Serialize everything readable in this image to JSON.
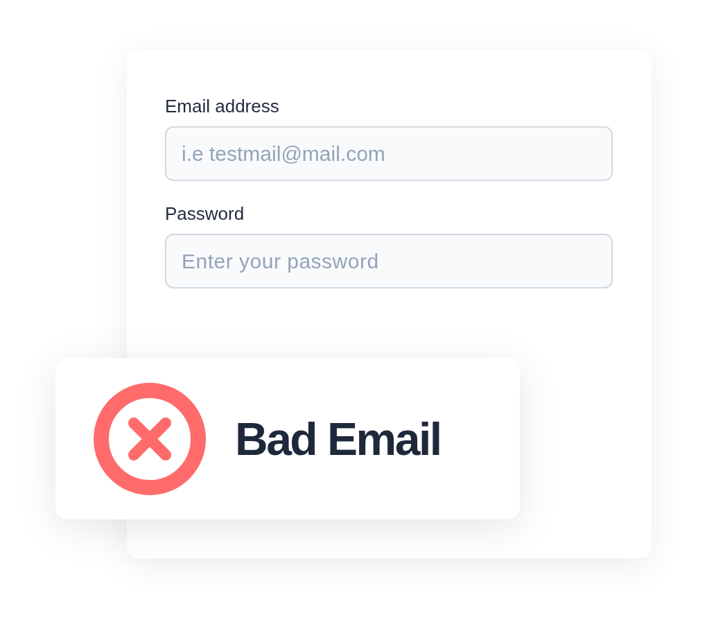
{
  "form": {
    "fields": [
      {
        "label": "Email address",
        "placeholder": "i.e testmail@mail.com",
        "kind": "text"
      },
      {
        "label": "Password",
        "placeholder": "Enter your password",
        "kind": "password"
      }
    ]
  },
  "toast": {
    "kind": "error",
    "message": "Bad Email"
  }
}
